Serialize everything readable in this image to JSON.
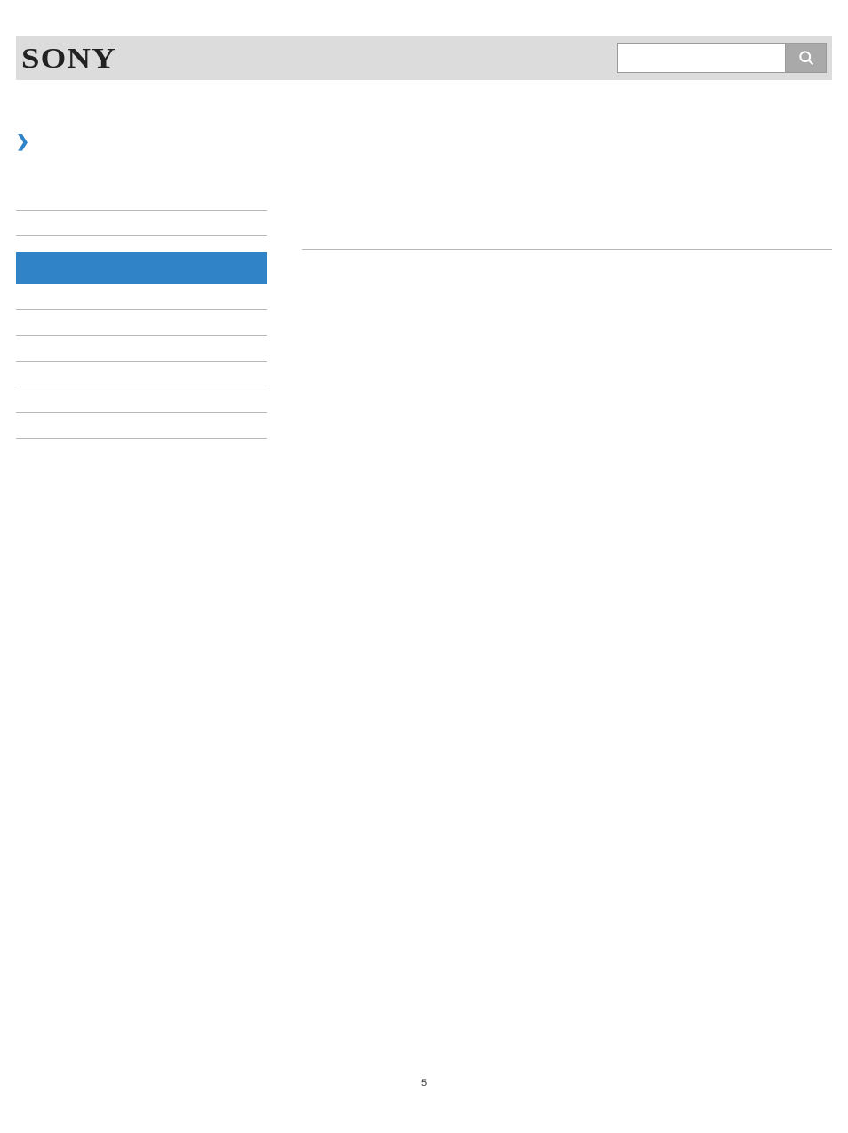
{
  "header": {
    "brand": "SONY",
    "search_placeholder": ""
  },
  "breadcrumb": {
    "label": ""
  },
  "sidebar": {
    "items": [
      {
        "label": ""
      },
      {
        "label": ""
      },
      {
        "label": "",
        "active": true
      },
      {
        "label": ""
      },
      {
        "label": ""
      },
      {
        "label": ""
      },
      {
        "label": ""
      },
      {
        "label": ""
      },
      {
        "label": ""
      }
    ]
  },
  "page_number": "5"
}
